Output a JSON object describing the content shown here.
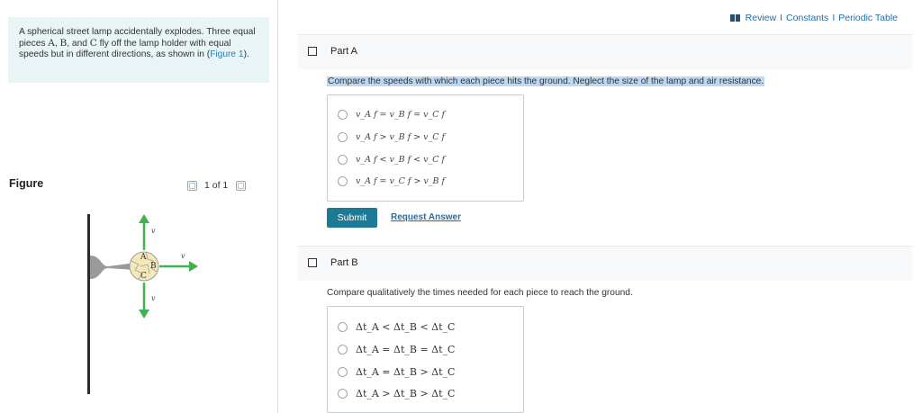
{
  "problem": {
    "text_before": "A spherical street lamp accidentally explodes. Three equal pieces ",
    "var_a": "A",
    "var_b": "B",
    "var_c": "C",
    "text_mid1": ", ",
    "text_mid2": ", and ",
    "text_after": " fly off the lamp holder with equal speeds but in different directions, as shown in ",
    "paren_open": "(",
    "figure_link": "Figure 1",
    "paren_close": ")."
  },
  "figure": {
    "label": "Figure",
    "pager": "1 of 1",
    "velocity_label": "v",
    "piece_a": "A",
    "piece_b": "B",
    "piece_c": "C",
    "colors": {
      "arrow": "#3fb34f",
      "holder": "#9a9a9a",
      "lamp": "#f4e7b8",
      "pole": "#2b2b2b"
    }
  },
  "top_links": {
    "review": "Review",
    "constants": "Constants",
    "periodic": "Periodic Table",
    "separator": "I"
  },
  "part_a": {
    "label": "Part A",
    "question": "Compare the speeds with which each piece hits the ground. Neglect the size of the lamp and air resistance.",
    "choices": [
      "v_A f = v_B f = v_C f",
      "v_A f > v_B f > v_C f",
      "v_A f < v_B f < v_C f",
      "v_A f = v_C f > v_B f"
    ],
    "submit": "Submit",
    "request": "Request Answer"
  },
  "part_b": {
    "label": "Part B",
    "question": "Compare qualitatively the times needed for each piece to reach the ground.",
    "choices": [
      "Δt_A < Δt_B < Δt_C",
      "Δt_A = Δt_B = Δt_C",
      "Δt_A = Δt_B > Δt_C",
      "Δt_A > Δt_B > Δt_C"
    ]
  },
  "accent": "#1c7a94"
}
